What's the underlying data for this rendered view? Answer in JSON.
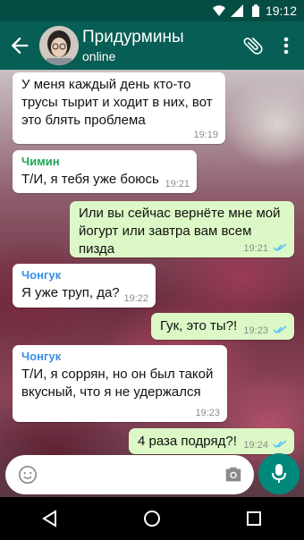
{
  "status_bar": {
    "time": "19:12"
  },
  "header": {
    "name": "Придурмины",
    "status": "online"
  },
  "colors": {
    "accent": "#075e54",
    "in_bubble": "#ffffff",
    "out_bubble": "#dcf8c6",
    "read_ticks": "#4fc3f7",
    "chimin": "#1fa855",
    "chongguk": "#3a8ee6"
  },
  "messages": [
    {
      "direction": "in",
      "sender": "",
      "text": "У меня каждый день кто-то трусы тырит и ходит в них, вот это блять проблема",
      "time": "19:19"
    },
    {
      "direction": "in",
      "sender": "Чимин",
      "text": "Т/И, я тебя уже боюсь",
      "time": "19:21"
    },
    {
      "direction": "out",
      "sender": "",
      "text": "Или вы сейчас вернёте мне мой йогурт или завтра вам всем пизда",
      "time": "19:21",
      "ticks": "read"
    },
    {
      "direction": "in",
      "sender": "Чонгук",
      "text": "Я уже труп, да?",
      "time": "19:22"
    },
    {
      "direction": "out",
      "sender": "",
      "text": "Гук, это ты?!",
      "time": "19:23",
      "ticks": "read"
    },
    {
      "direction": "in",
      "sender": "Чонгук",
      "text": "Т/И, я соррян, но он был такой вкусный, что я не удержался",
      "time": "19:23"
    },
    {
      "direction": "out",
      "sender": "",
      "text": "4 раза подряд?!",
      "time": "19:24",
      "ticks": "read"
    }
  ],
  "icons": {
    "back": "arrow-left-icon",
    "attach": "paperclip-icon",
    "more": "more-vert-icon",
    "emoji": "emoji-icon",
    "camera": "camera-icon",
    "mic": "mic-icon"
  }
}
